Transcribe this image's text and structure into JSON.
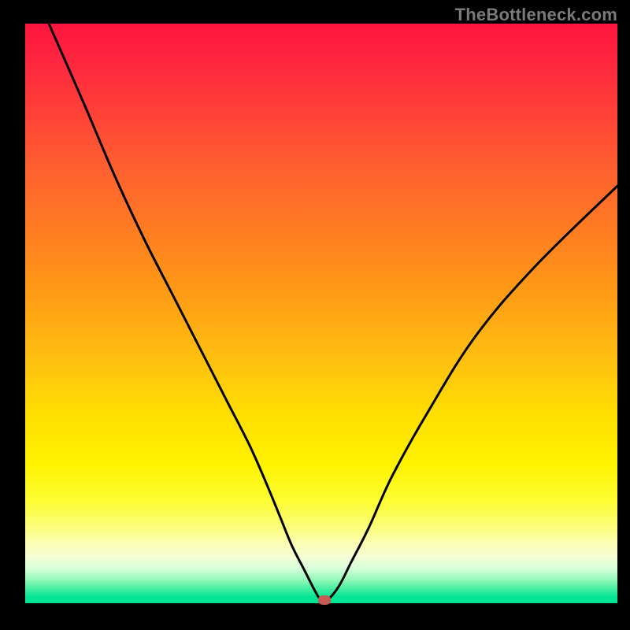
{
  "watermark": "TheBottleneck.com",
  "chart_data": {
    "type": "line",
    "title": "",
    "xlabel": "",
    "ylabel": "",
    "xlim": [
      0,
      100
    ],
    "ylim": [
      0,
      100
    ],
    "grid": false,
    "series": [
      {
        "name": "bottleneck-curve",
        "x": [
          4,
          10,
          15,
          20,
          25,
          30,
          34,
          38,
          41,
          43,
          45,
          47,
          49,
          50,
          51,
          53,
          55,
          58,
          62,
          68,
          76,
          86,
          100
        ],
        "values": [
          100,
          86,
          74,
          63,
          53,
          43,
          35,
          27,
          20,
          15,
          10,
          6,
          2,
          0.5,
          0.5,
          3,
          7,
          13,
          22,
          33,
          46,
          58,
          72
        ]
      }
    ],
    "marker": {
      "x": 50.5,
      "y": 0.5,
      "color": "#c75b53"
    },
    "gradient_stops": [
      {
        "pos": 0,
        "color": "#ff1540"
      },
      {
        "pos": 0.5,
        "color": "#ffe000"
      },
      {
        "pos": 0.9,
        "color": "#fcfd74"
      },
      {
        "pos": 1.0,
        "color": "#00e494"
      }
    ]
  }
}
